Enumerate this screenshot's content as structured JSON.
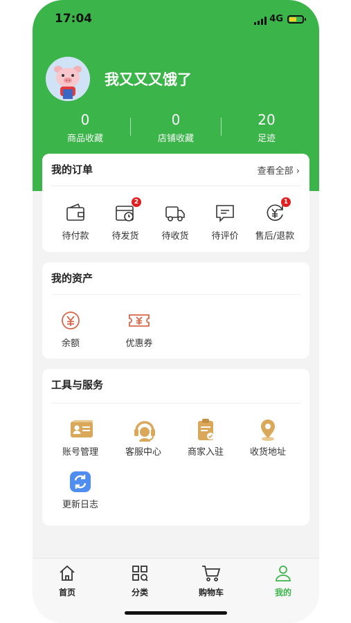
{
  "status_bar": {
    "time": "17:04",
    "network": "4G"
  },
  "profile": {
    "username": "我又又又饿了"
  },
  "stats": [
    {
      "value": "0",
      "label": "商品收藏"
    },
    {
      "value": "0",
      "label": "店铺收藏"
    },
    {
      "value": "20",
      "label": "足迹"
    }
  ],
  "orders": {
    "title": "我的订单",
    "view_all": "查看全部 ›",
    "items": [
      {
        "label": "待付款",
        "icon": "wallet-icon",
        "badge": ""
      },
      {
        "label": "待发货",
        "icon": "pending-shipment-icon",
        "badge": "2"
      },
      {
        "label": "待收货",
        "icon": "truck-icon",
        "badge": ""
      },
      {
        "label": "待评价",
        "icon": "comment-icon",
        "badge": ""
      },
      {
        "label": "售后/退款",
        "icon": "refund-icon",
        "badge": "1"
      }
    ]
  },
  "assets": {
    "title": "我的资产",
    "items": [
      {
        "label": "余额",
        "icon": "balance-icon"
      },
      {
        "label": "优惠券",
        "icon": "coupon-icon"
      }
    ]
  },
  "tools": {
    "title": "工具与服务",
    "items": [
      {
        "label": "账号管理",
        "icon": "id-card-icon"
      },
      {
        "label": "客服中心",
        "icon": "headset-icon"
      },
      {
        "label": "商家入驻",
        "icon": "clipboard-icon"
      },
      {
        "label": "收货地址",
        "icon": "location-icon"
      },
      {
        "label": "更新日志",
        "icon": "refresh-icon"
      }
    ]
  },
  "tabbar": {
    "items": [
      {
        "label": "首页",
        "icon": "home-icon",
        "active": false
      },
      {
        "label": "分类",
        "icon": "category-icon",
        "active": false
      },
      {
        "label": "购物车",
        "icon": "cart-icon",
        "active": false
      },
      {
        "label": "我的",
        "icon": "user-icon",
        "active": true
      }
    ]
  },
  "colors": {
    "brand_green": "#3bb44a",
    "badge_red": "#e02020",
    "asset_red": "#d9654a",
    "tool_gold": "#d9a85a",
    "update_blue": "#4f8ef0"
  }
}
